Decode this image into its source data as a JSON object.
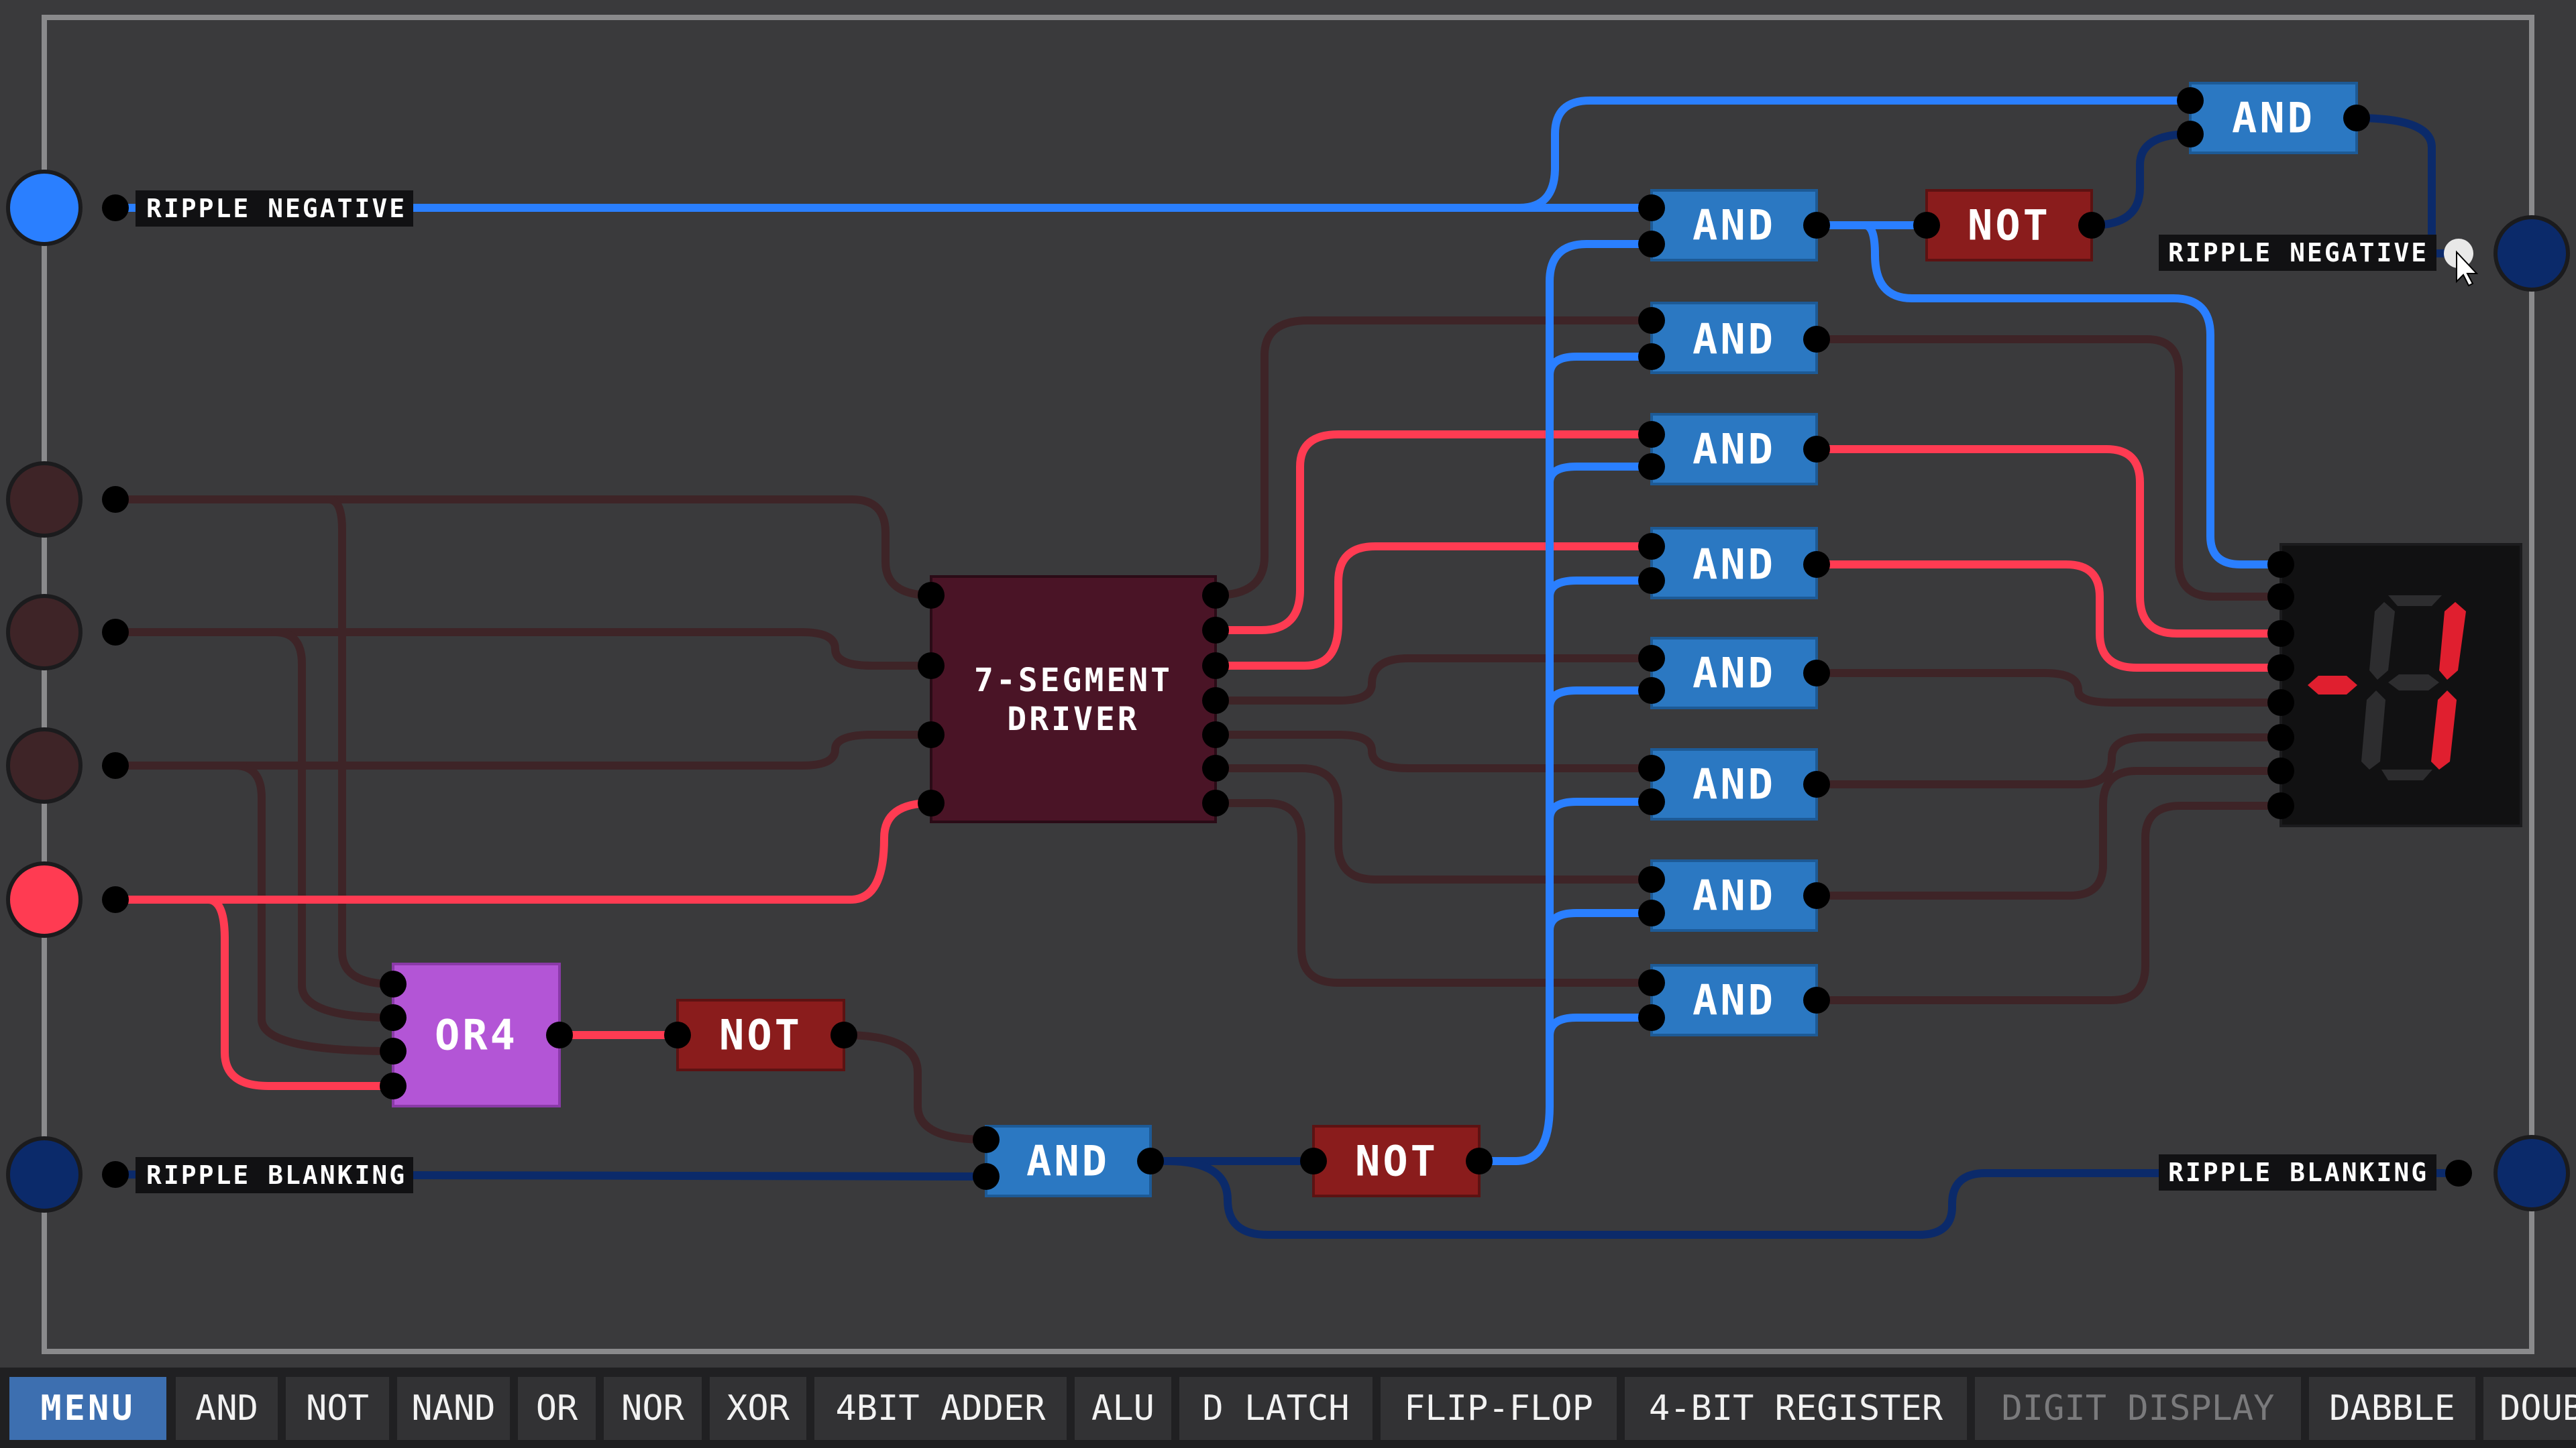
{
  "canvas": {
    "io_labels": {
      "ripple_negative_in": "RIPPLE NEGATIVE",
      "ripple_blanking_in": "RIPPLE BLANKING",
      "ripple_negative_out": "RIPPLE NEGATIVE",
      "ripple_blanking_out": "RIPPLE BLANKING"
    },
    "gates": {
      "and_top": "AND",
      "and_neg": "AND",
      "not_neg": "NOT",
      "and_seg_a": "AND",
      "and_seg_b": "AND",
      "and_seg_c": "AND",
      "and_seg_d": "AND",
      "and_seg_e": "AND",
      "and_seg_f": "AND",
      "and_seg_g": "AND",
      "driver_line1": "7-SEGMENT",
      "driver_line2": "DRIVER",
      "or4": "OR4",
      "not_or": "NOT",
      "and_blank": "AND",
      "not_blank": "NOT"
    },
    "colors": {
      "wire_on": "#2a7fff",
      "wire_red_on": "#ff3b52",
      "wire_off": "#3e2427",
      "wire_blank": "#0b2a6a",
      "and_gate": "#2b78c2",
      "not_gate": "#8a1c1c",
      "or4_gate": "#b355d6",
      "driver": "#4a1426",
      "display_segment_on": "#e01f2f"
    }
  },
  "toolbar": {
    "items": [
      {
        "label": "MENU",
        "active": true
      },
      {
        "label": "AND"
      },
      {
        "label": "NOT"
      },
      {
        "label": "NAND"
      },
      {
        "label": "OR"
      },
      {
        "label": "NOR"
      },
      {
        "label": "XOR"
      },
      {
        "label": "4BIT ADDER"
      },
      {
        "label": "ALU"
      },
      {
        "label": "D LATCH"
      },
      {
        "label": "FLIP-FLOP"
      },
      {
        "label": "4-BIT REGISTER"
      },
      {
        "label": "DIGIT DISPLAY",
        "disabled": true
      },
      {
        "label": "DABBLE"
      },
      {
        "label": "DOUBLE"
      }
    ]
  }
}
